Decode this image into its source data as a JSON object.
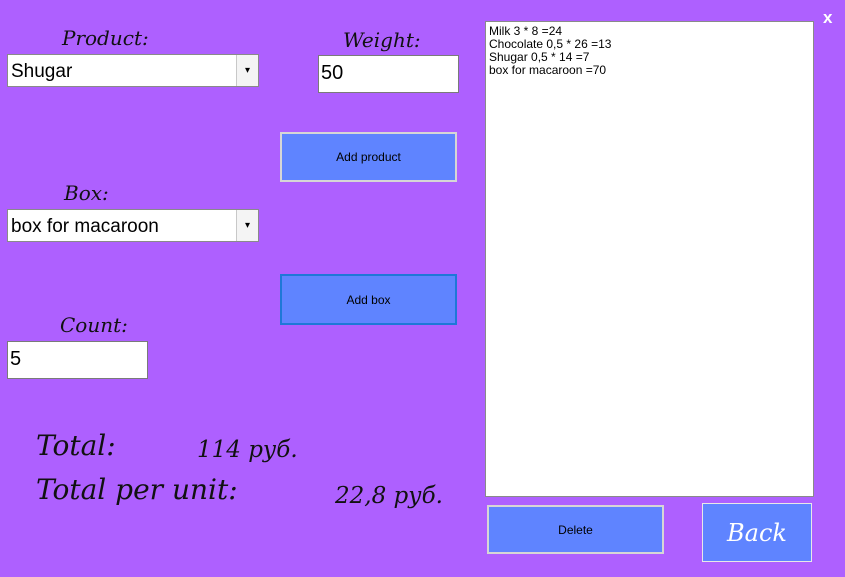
{
  "window": {
    "close_label": "x"
  },
  "product": {
    "label": "Product:",
    "selected": "Shugar",
    "arrow": "▾"
  },
  "weight": {
    "label": "Weight:",
    "value": "50"
  },
  "add_product": {
    "label": "Add product"
  },
  "box": {
    "label": "Box:",
    "selected": "box for macaroon",
    "arrow": "▾"
  },
  "add_box": {
    "label": "Add box"
  },
  "count": {
    "label": "Count:",
    "value": "5"
  },
  "totals": {
    "total_label": "Total:",
    "total_value": "114 руб.",
    "per_unit_label": "Total per unit:",
    "per_unit_value": "22,8 руб."
  },
  "items": [
    "Milk 3 * 8 =24",
    "Chocolate 0,5 * 26 =13",
    "Shugar 0,5 * 14 =7",
    "box for macaroon =70"
  ],
  "delete": {
    "label": "Delete"
  },
  "back": {
    "label": "Back"
  },
  "colors": {
    "background": "#ae60ff",
    "button": "#5f84ff"
  }
}
